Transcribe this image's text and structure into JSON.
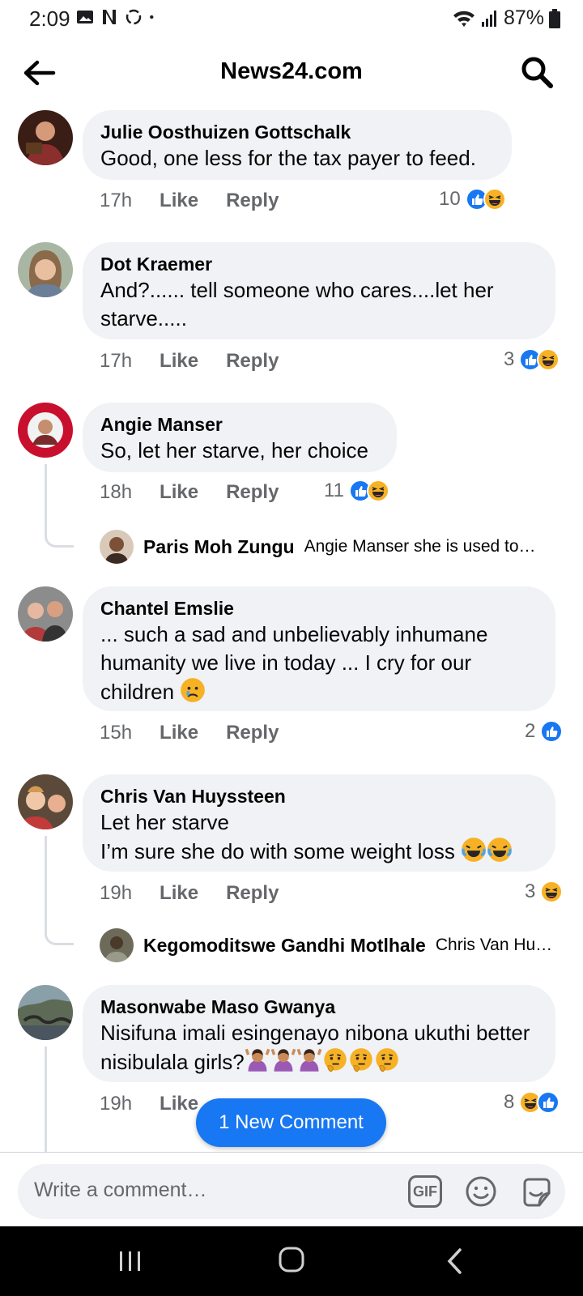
{
  "status": {
    "time": "2:09",
    "battery": "87%"
  },
  "header": {
    "title": "News24.com"
  },
  "comments": [
    {
      "name": "Julie Oosthuizen Gottschalk",
      "text": "Good, one less for the tax payer to feed.",
      "time": "17h",
      "like": "Like",
      "reply": "Reply",
      "reactions": "10"
    },
    {
      "name": "Dot Kraemer",
      "text": "And?...... tell someone who cares....let her starve.....",
      "time": "17h",
      "like": "Like",
      "reply": "Reply",
      "reactions": "3"
    },
    {
      "name": "Angie Manser",
      "text": "So, let her starve, her choice",
      "time": "18h",
      "like": "Like",
      "reply": "Reply",
      "reactions": "11",
      "reply_preview": {
        "name": "Paris Moh Zungu",
        "text": "Angie Manser she is used to…"
      }
    },
    {
      "name": "Chantel Emslie",
      "text": "... such a sad and unbelievably inhumane humanity we live in today ... I cry for our children",
      "time": "15h",
      "like": "Like",
      "reply": "Reply",
      "reactions": "2"
    },
    {
      "name": "Chris Van Huyssteen",
      "line1": "Let her starve",
      "line2": "I’m sure she do with some weight loss",
      "time": "19h",
      "like": "Like",
      "reply": "Reply",
      "reactions": "3",
      "reply_preview": {
        "name": "Kegomoditswe Gandhi Motlhale",
        "text": "Chris Van Hu…"
      }
    },
    {
      "name": "Masonwabe Maso Gwanya",
      "text": "Nisifuna imali  esingenayo nibona ukuthi better nisibulala girls?",
      "time": "19h",
      "like": "Like",
      "reactions": "8"
    }
  ],
  "new_comment_pill": "1 New Comment",
  "composer": {
    "placeholder": "Write a comment…",
    "gif_label": "GIF"
  },
  "icons": {
    "like": "like-reaction-icon",
    "haha": "haha-reaction-icon",
    "sad": "crying-emoji-icon",
    "colors": {
      "like_blue": "#1877f2",
      "haha_yellow": "#f7b125",
      "bubble_gray": "#f0f2f5"
    }
  }
}
